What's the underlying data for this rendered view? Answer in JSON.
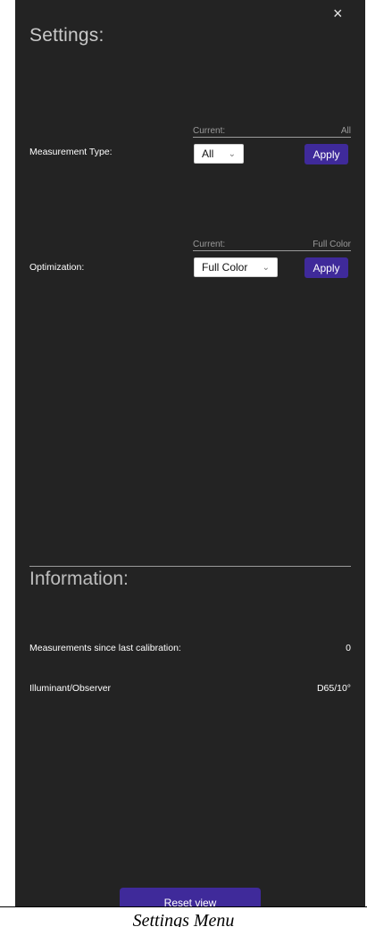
{
  "settings": {
    "title": "Settings:",
    "close_icon": "×",
    "measurement_type": {
      "label": "Measurement Type:",
      "current_label": "Current:",
      "current_value": "All",
      "selected": "All",
      "apply_label": "Apply"
    },
    "optimization": {
      "label": "Optimization:",
      "current_label": "Current:",
      "current_value": "Full Color",
      "selected": "Full Color",
      "apply_label": "Apply"
    }
  },
  "information": {
    "title": "Information:",
    "rows": [
      {
        "label": "Measurements since last calibration:",
        "value": "0"
      },
      {
        "label": "Illuminant/Observer",
        "value": "D65/10°"
      }
    ]
  },
  "reset_button_label": "Reset view",
  "caption": "Settings Menu",
  "colors": {
    "panel_bg": "#232323",
    "accent": "#3f2a9a"
  }
}
